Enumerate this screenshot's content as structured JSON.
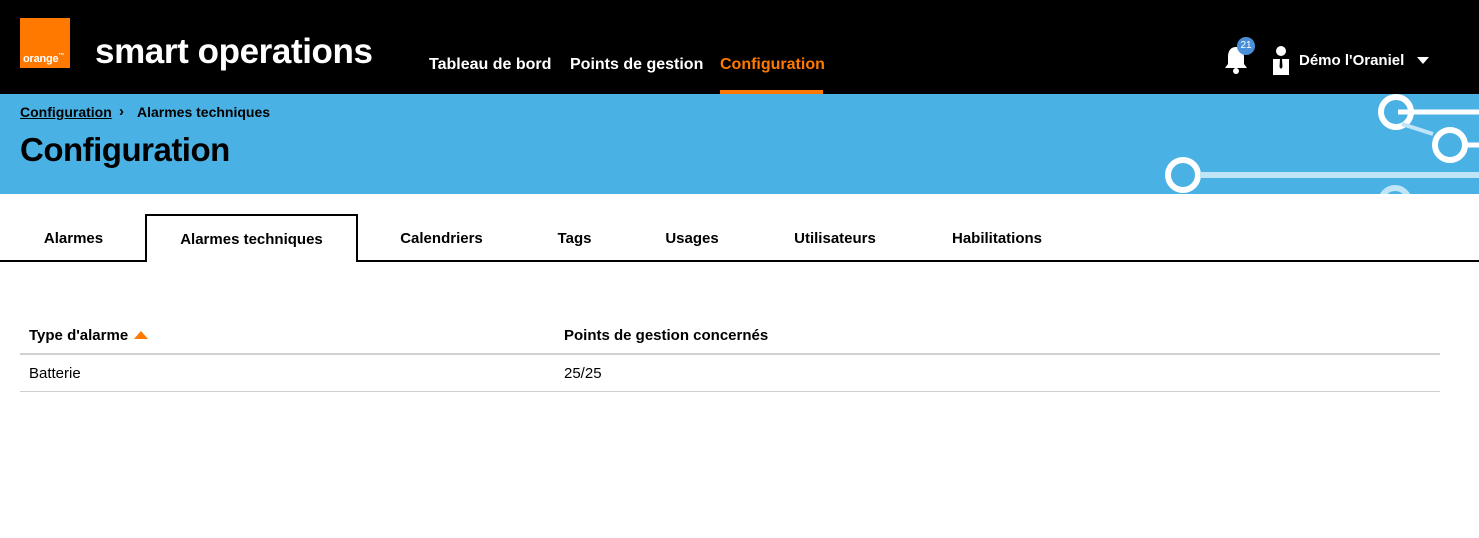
{
  "brand": {
    "logo_text": "orange",
    "logo_tm": "™",
    "app_title": "smart operations",
    "colors": {
      "brand_orange": "#ff7900",
      "header_bg": "#000000",
      "banner_blue": "#4ab1e5",
      "badge_blue": "#4a90d9"
    }
  },
  "nav": {
    "items": [
      {
        "label": "Tableau de bord",
        "active": false
      },
      {
        "label": "Points de gestion",
        "active": false
      },
      {
        "label": "Configuration",
        "active": true
      }
    ]
  },
  "notifications": {
    "icon": "bell-icon",
    "count": "21"
  },
  "user": {
    "icon": "user-icon",
    "name": "Démo l'Oraniel",
    "caret_icon": "caret-down-icon"
  },
  "breadcrumb": {
    "parent": "Configuration",
    "separator": "›",
    "current": "Alarmes techniques"
  },
  "page": {
    "title": "Configuration"
  },
  "tabs": [
    {
      "label": "Alarmes",
      "active": false
    },
    {
      "label": "Alarmes techniques",
      "active": true
    },
    {
      "label": "Calendriers",
      "active": false
    },
    {
      "label": "Tags",
      "active": false
    },
    {
      "label": "Usages",
      "active": false
    },
    {
      "label": "Utilisateurs",
      "active": false
    },
    {
      "label": "Habilitations",
      "active": false
    }
  ],
  "table": {
    "columns": [
      {
        "label": "Type d'alarme",
        "sorted": "ascending"
      },
      {
        "label": "Points de gestion concernés"
      }
    ],
    "rows": [
      {
        "type": "Batterie",
        "points": "25/25"
      }
    ]
  }
}
